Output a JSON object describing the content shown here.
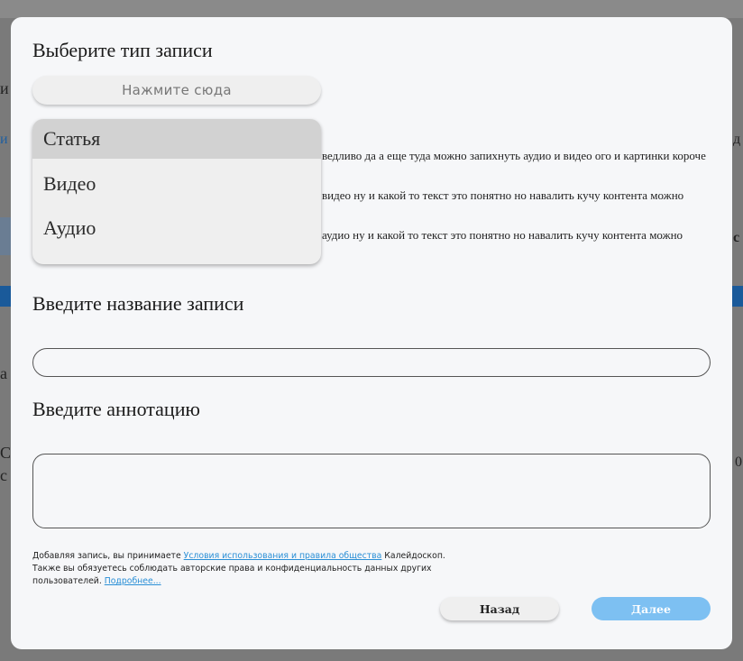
{
  "modal": {
    "type_heading": "Выберите тип записи",
    "select_placeholder": "Нажмите сюда",
    "type_options": [
      "Статья",
      "Видео",
      "Аудио"
    ],
    "selected_option": "Статья",
    "title_heading": "Введите название записи",
    "title_value": "",
    "annotation_heading": "Введите аннотацию",
    "annotation_value": "",
    "legal": {
      "part1": "Добавляя запись, вы принимаете ",
      "terms_link": "Условия использования и правила общества",
      "part2": " Калейдоскоп.",
      "line2": "Также вы обязуетесь соблюдать авторские права и конфиденциальность данных других",
      "line3": "пользователей. ",
      "more_link": "Подробнее..."
    },
    "back_button": "Назад",
    "next_button": "Далее"
  },
  "background_text": {
    "row1": "ведливо да а еще туда можно запихнуть аудио и видео ого и картинки короче",
    "row2": "видео ну и какой то текст это понятно но навалить кучу контента можно",
    "row3": "аудио ну и какой то текст это понятно но навалить кучу контента можно"
  }
}
